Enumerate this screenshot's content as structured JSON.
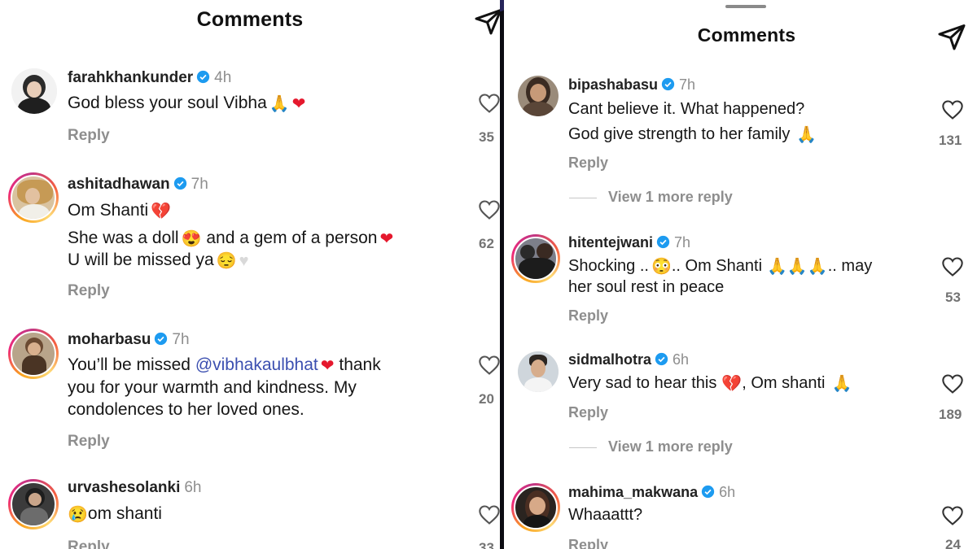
{
  "left": {
    "title": "Comments",
    "comments": [
      {
        "username": "farahkhankunder",
        "time": "4h",
        "lines": [
          "God bless your soul Vibha"
        ],
        "reply": "Reply",
        "likes": "35"
      },
      {
        "username": "ashitadhawan",
        "time": "7h",
        "lines": [
          "Om Shanti",
          "She was a doll",
          "and a gem of a person",
          "U will be missed ya"
        ],
        "reply": "Reply",
        "likes": "62"
      },
      {
        "username": "moharbasu",
        "time": "7h",
        "lines": [
          "You’ll be missed",
          "@vibhakaulbhat",
          "thank",
          "you for your warmth and kindness. My",
          "condolences to her loved ones."
        ],
        "reply": "Reply",
        "likes": "20"
      },
      {
        "username": "urvashesolanki",
        "time": "6h",
        "lines": [
          "om shanti"
        ],
        "reply": "Reply",
        "likes": "33"
      }
    ]
  },
  "right": {
    "title": "Comments",
    "comments": [
      {
        "username": "bipashabasu",
        "time": "7h",
        "lines": [
          "Cant believe it. What happened?",
          "God give strength to her family"
        ],
        "reply": "Reply",
        "likes": "131",
        "view_more": "View 1 more reply"
      },
      {
        "username": "hitentejwani",
        "time": "7h",
        "lines": [
          "Shocking ..",
          ".. Om Shanti",
          ".. may",
          "her soul rest in peace"
        ],
        "reply": "Reply",
        "likes": "53"
      },
      {
        "username": "sidmalhotra",
        "time": "6h",
        "lines": [
          "Very sad to hear this",
          ", Om shanti"
        ],
        "reply": "Reply",
        "likes": "189",
        "view_more": "View 1 more reply"
      },
      {
        "username": "mahima_makwana",
        "time": "6h",
        "lines": [
          "Whaaattt?"
        ],
        "reply": "Reply",
        "likes": "24"
      }
    ]
  },
  "icons": {
    "send": "paper-plane-icon",
    "like": "heart-outline-icon",
    "verified": "verified-badge-icon"
  },
  "colors": {
    "verified": "#1d9bf0",
    "mention": "#3b4fb0",
    "muted": "#8e8e8e"
  }
}
